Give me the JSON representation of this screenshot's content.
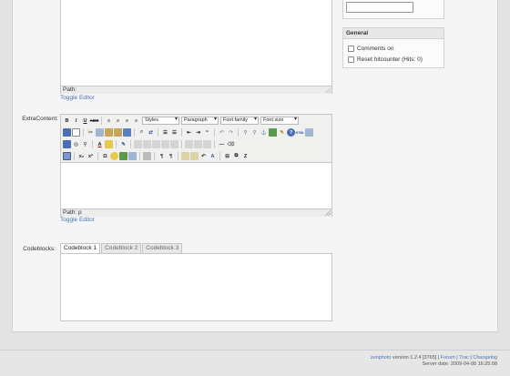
{
  "top_editor": {
    "path_label": "Path:",
    "toggle_label": "Toggle Editor"
  },
  "extra_content": {
    "label": "ExtraContent:",
    "path_label": "Path: p",
    "toggle_label": "Toggle Editor",
    "selects": [
      "Styles",
      "Paragraph",
      "Font family",
      "Font size"
    ]
  },
  "codeblocks": {
    "label": "Codeblocks:",
    "tabs": [
      "Codeblock 1",
      "Codeblock 2",
      "Codeblock 3"
    ]
  },
  "sidebar": {
    "general_title": "General",
    "comments_label": "Comments on",
    "reset_label": "Reset hitcounter (Hits: 0)"
  },
  "footer": {
    "brand": "zenphoto",
    "version": "version 1.2.4 [3765] |",
    "forum": "Forum",
    "trac": "Trac",
    "changelog": "Changelog",
    "sep": "|",
    "server_date": "Server date: 2009-04-08 16:25:08"
  },
  "colors": {
    "link": "#4a73b8",
    "panel_bg": "#f5f5f5",
    "page_bg": "#e3e3e3"
  }
}
